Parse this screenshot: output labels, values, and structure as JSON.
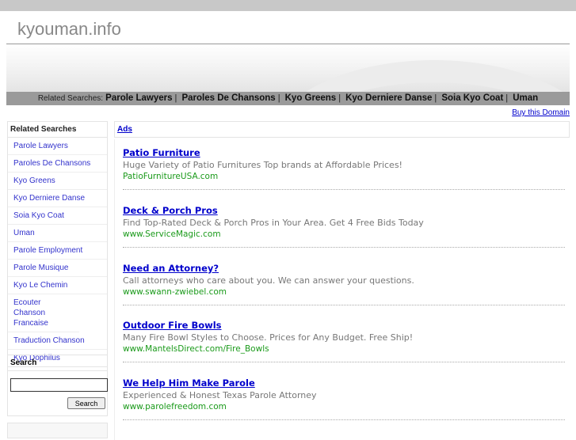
{
  "site_title": "kyouman.info",
  "related_bar": {
    "label": "Related Searches:",
    "links": [
      "Parole Lawyers",
      "Paroles De Chansons",
      "Kyo Greens",
      "Kyo Derniere Danse",
      "Soia Kyo Coat",
      "Uman"
    ]
  },
  "buy_domain": "Buy this Domain",
  "sidebar": {
    "title": "Related Searches",
    "items": [
      "Parole Lawyers",
      "Paroles De Chansons",
      "Kyo Greens",
      "Kyo Derniere Danse",
      "Soia Kyo Coat",
      "Uman",
      "Parole Employment",
      "Parole Musique",
      "Kyo Le Chemin",
      "Ecouter Chanson Francaise",
      "Traduction Chanson",
      "Kyo Dophilus"
    ]
  },
  "search": {
    "title": "Search",
    "button": "Search",
    "value": ""
  },
  "ads_label": "Ads",
  "ads": [
    {
      "title": "Patio Furniture",
      "desc": "Huge Variety of Patio Furnitures Top brands at Affordable Prices!",
      "url": "PatioFurnitureUSA.com"
    },
    {
      "title": "Deck & Porch Pros",
      "desc": "Find Top-Rated Deck & Porch Pros in Your Area. Get 4 Free Bids Today",
      "url": "www.ServiceMagic.com"
    },
    {
      "title": "Need an Attorney?",
      "desc": "Call attorneys who care about you. We can answer your questions.",
      "url": "www.swann-zwiebel.com"
    },
    {
      "title": "Outdoor Fire Bowls",
      "desc": "Many Fire Bowl Styles to Choose. Prices for Any Budget. Free Ship!",
      "url": "www.MantelsDirect.com/Fire_Bowls"
    },
    {
      "title": "We Help Him Make Parole",
      "desc": "Experienced & Honest Texas Parole Attorney",
      "url": "www.parolefreedom.com"
    }
  ]
}
